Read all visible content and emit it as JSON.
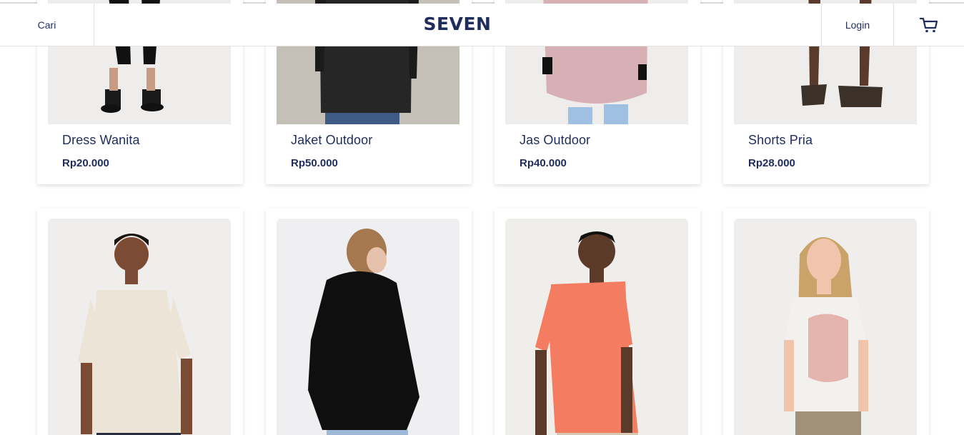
{
  "header": {
    "search_label": "Cari",
    "logo_text": "SEVEN",
    "login_label": "Login",
    "cart_icon": "cart-icon"
  },
  "products_row1": [
    {
      "name": "Dress Wanita",
      "price": "Rp20.000",
      "bg": "#efedeb"
    },
    {
      "name": "Jaket Outdoor",
      "price": "Rp50.000",
      "bg": "#bfbab3"
    },
    {
      "name": "Jas Outdoor",
      "price": "Rp40.000",
      "bg": "#efedec"
    },
    {
      "name": "Shorts Pria",
      "price": "Rp28.000",
      "bg": "#efedeb"
    }
  ],
  "products_row2": [
    {
      "bg": "#efeeec"
    },
    {
      "bg": "#efeef0"
    },
    {
      "bg": "#efeeea"
    },
    {
      "bg": "#efeeed"
    }
  ],
  "colors": {
    "brand": "#1f2d5c",
    "border": "#e2e2e2",
    "coral_tee": "#f47c60",
    "pink_coat": "#d6b0b5"
  }
}
